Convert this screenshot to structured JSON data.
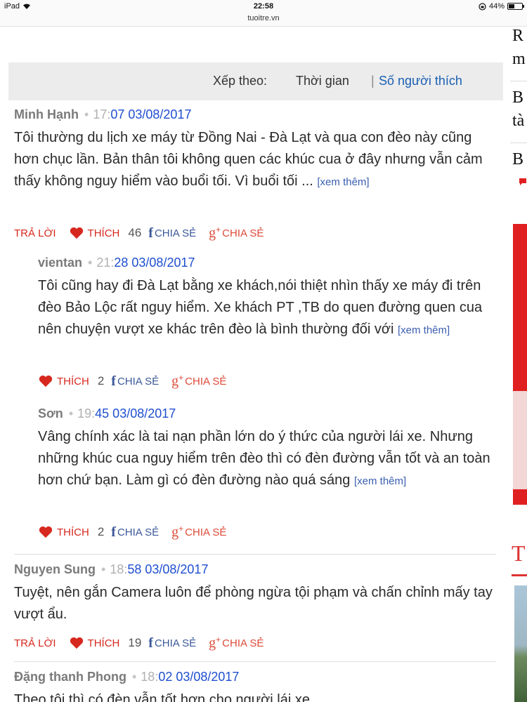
{
  "status_bar": {
    "device": "iPad",
    "time": "22:58",
    "url": "tuoitre.vn",
    "battery_percent": "44%",
    "battery_level": 0.44
  },
  "sort": {
    "label": "Xếp theo:",
    "option_time": "Thời gian",
    "separator": "|",
    "option_likes": "Số người thích"
  },
  "actions": {
    "reply": "TRẢ LỜI",
    "like": "THÍCH",
    "share_fb": "CHIA SẺ",
    "share_gplus": "CHIA SẺ",
    "more": "[xem thêm]"
  },
  "comments": [
    {
      "author": "Minh Hạnh",
      "time_a": "17:",
      "time_b": "07 03/08/2017",
      "body": "Tôi thường du lịch xe máy từ Đồng Nai - Đà Lạt và qua con đèo này cũng hơn chục lần. Bản thân tôi không quen các khúc cua ở đây nhưng vẫn cảm thấy không nguy hiểm vào buổi tối. Vì buổi tối ...",
      "likes": "46"
    },
    {
      "author": "vientan",
      "time_a": "21:",
      "time_b": "28 03/08/2017",
      "body": "Tôi cũng hay đi Đà Lạt bằng xe khách,nói thiệt nhìn thấy xe máy đi trên đèo Bảo Lộc rất nguy hiểm. Xe khách PT ,TB do quen đường quen cua nên chuyện vượt xe khác trên đèo là bình thường đối với",
      "likes": "2"
    },
    {
      "author": "Sơn",
      "time_a": "19:",
      "time_b": "45 03/08/2017",
      "body": "Vâng chính xác là tai nạn phần lớn do ý thức của người lái xe. Nhưng những khúc cua nguy hiểm trên đèo thì có đèn đường vẫn tốt và an toàn hơn chứ bạn. Làm gì có đèn đường nào quá sáng",
      "likes": "2"
    },
    {
      "author": "Nguyen Sung",
      "time_a": "18:",
      "time_b": "58 03/08/2017",
      "body": "Tuyệt, nên gắn Camera luôn để phòng ngừa tội phạm và chấn chỉnh mấy tay vượt ẩu.",
      "likes": "19"
    },
    {
      "author": "Đặng thanh Phong",
      "time_a": "18:",
      "time_b": "02 03/08/2017",
      "body": "Theo tôi thì có đèn vẫn tốt hơn cho người lái xe."
    }
  ],
  "right_column": {
    "lines": [
      "R",
      "m",
      "B",
      "tà",
      "B"
    ],
    "heading_letter": "T"
  },
  "colors": {
    "accent_red": "#d6281e",
    "link_blue": "#1f4fd0",
    "facebook": "#3b5998",
    "gplus": "#dd4b39"
  }
}
